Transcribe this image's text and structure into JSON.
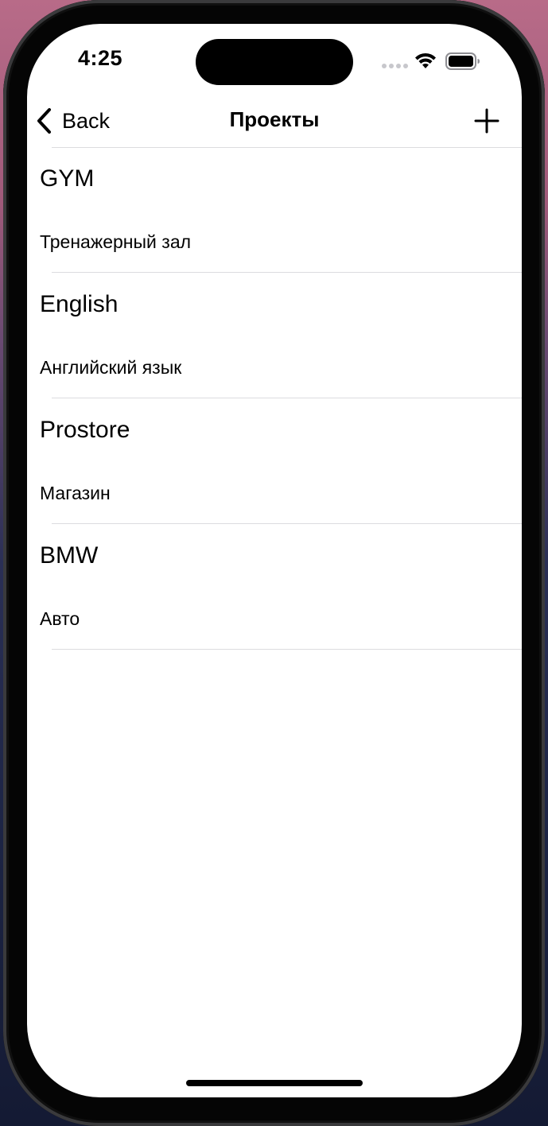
{
  "status_bar": {
    "time": "4:25",
    "icons": [
      "signal-dots-icon",
      "wifi-icon",
      "battery-icon"
    ]
  },
  "nav": {
    "back_label": "Back",
    "title": "Проекты",
    "add_icon": "plus-icon"
  },
  "projects": [
    {
      "title": "GYM",
      "subtitle": "Тренажерный зал"
    },
    {
      "title": "English",
      "subtitle": "Английский язык"
    },
    {
      "title": "Prostore",
      "subtitle": "Магазин"
    },
    {
      "title": "BMW",
      "subtitle": "Авто"
    }
  ],
  "colors": {
    "background": "#ffffff",
    "text": "#000000",
    "separator": "#dcdcdf"
  }
}
